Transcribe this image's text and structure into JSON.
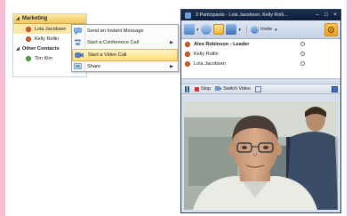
{
  "contacts": {
    "group_marketing": "Marketing",
    "group_other": "Other Contacts",
    "marketing": [
      {
        "name": "Lola Jacobsen",
        "status_color": "#e05a1f",
        "selected": true
      },
      {
        "name": "Kelly Rollin",
        "status_color": "#e05a1f",
        "selected": false
      }
    ],
    "other": [
      {
        "name": "Tim Kim",
        "status_color": "#3fae3f",
        "selected": false
      }
    ]
  },
  "context_menu": {
    "items": [
      {
        "label": "Send an Instant Message",
        "icon": "chat-icon",
        "submenu": false,
        "highlighted": false
      },
      {
        "label": "Start a Conference Call",
        "icon": "phone-icon",
        "submenu": true,
        "highlighted": false
      },
      {
        "label": "Start a Video Call",
        "icon": "video-camera-icon",
        "submenu": false,
        "highlighted": true
      },
      {
        "label": "Share",
        "icon": "share-icon",
        "submenu": true,
        "highlighted": false
      }
    ]
  },
  "conversation": {
    "title": "3 Participants - Lola Jacobsen, Kelly Rolli...",
    "invite_label": "Invite",
    "participants": [
      {
        "name": "Alex Robinson - Leader",
        "leader": true,
        "status_color": "#e05a1f"
      },
      {
        "name": "Kelly Rollin",
        "leader": false,
        "status_color": "#e05a1f"
      },
      {
        "name": "Lola Jacobsen",
        "leader": false,
        "status_color": "#e05a1f"
      }
    ],
    "video_bar": {
      "stop_label": "Stop",
      "switch_label": "Switch Video"
    }
  },
  "colors": {
    "frame_pink": "#f6bfd8",
    "title_bar": "#12233f",
    "highlight": "#fddc7c",
    "presence_busy": "#e05a1f",
    "presence_available": "#3fae3f"
  }
}
